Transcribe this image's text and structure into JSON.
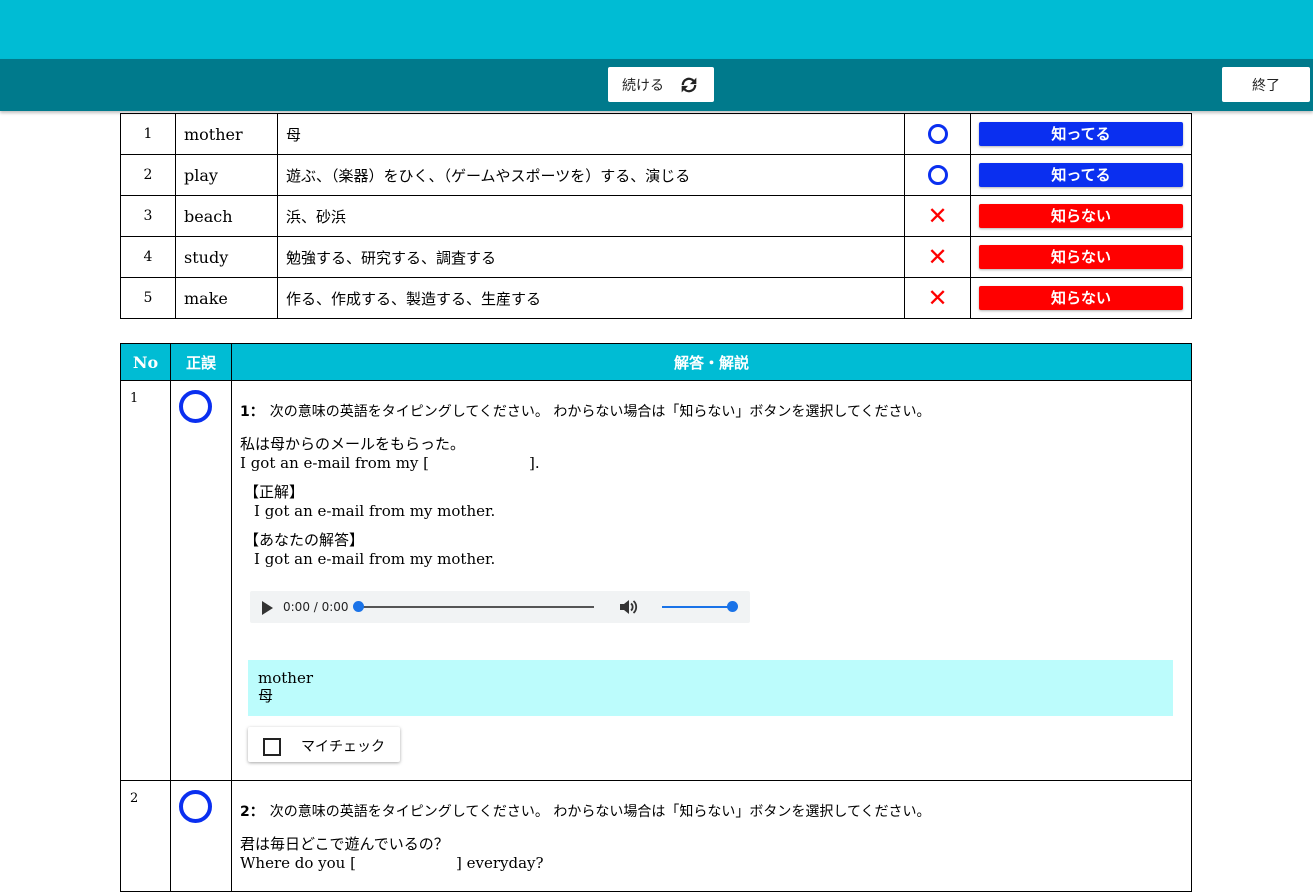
{
  "nav": {
    "continue_label": "続ける",
    "end_label": "終了"
  },
  "summary": [
    {
      "no": "1",
      "word": "mother",
      "meaning": "母",
      "result": "correct",
      "button": "知ってる"
    },
    {
      "no": "2",
      "word": "play",
      "meaning": "遊ぶ、（楽器）をひく、（ゲームやスポーツを）する、演じる",
      "result": "correct",
      "button": "知ってる"
    },
    {
      "no": "3",
      "word": "beach",
      "meaning": "浜、砂浜",
      "result": "wrong",
      "button": "知らない"
    },
    {
      "no": "4",
      "word": "study",
      "meaning": "勉強する、研究する、調査する",
      "result": "wrong",
      "button": "知らない"
    },
    {
      "no": "5",
      "word": "make",
      "meaning": "作る、作成する、製造する、生産する",
      "result": "wrong",
      "button": "知らない"
    }
  ],
  "colors": {
    "header": "#00bcd4",
    "nav": "#007a8c",
    "know": "#0a2ff0",
    "dont_know": "#ff0000",
    "hint_bg": "#bcfcfc"
  },
  "detail": {
    "headers": {
      "no": "No",
      "result": "正誤",
      "answer": "解答・解説"
    },
    "q1": {
      "no": "1",
      "index": "1：",
      "instruction": "次の意味の英語をタイピングしてください。 わからない場合は「知らない」ボタンを選択してください。",
      "jp": "私は母からのメールをもらった。",
      "en_pre": "I got an e-mail from my [",
      "en_post": "].",
      "correct_label": "【正解】",
      "correct": "I got an e-mail from my mother.",
      "yours_label": "【あなたの解答】",
      "yours": "I got an e-mail from my mother.",
      "audio_time": "0:00 / 0:00",
      "hint_word": "mother",
      "hint_meaning": "母",
      "check_label": "マイチェック"
    },
    "q2": {
      "no": "2",
      "index": "2：",
      "instruction": "次の意味の英語をタイピングしてください。 わからない場合は「知らない」ボタンを選択してください。",
      "jp": "君は毎日どこで遊んでいるの？",
      "en_pre": "Where do you [",
      "en_post": "] everyday?"
    }
  }
}
